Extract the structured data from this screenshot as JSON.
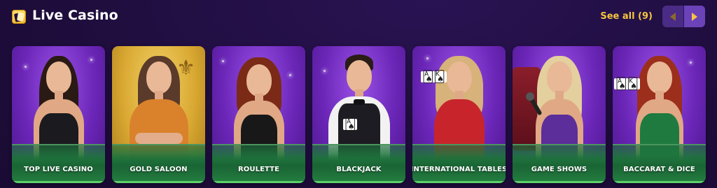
{
  "header": {
    "title": "Live Casino",
    "title_icon": "cards-icon",
    "see_all_label": "See all (9)",
    "prev_icon": "chevron-left-icon",
    "next_icon": "chevron-right-icon"
  },
  "colors": {
    "background": "#1e0d3c",
    "accent_gold": "#f5c542",
    "card_purple": "#7a32c9",
    "card_gold": "#e2b33a",
    "table_green": "#1f7a3f",
    "label_underline": "#5cd06a"
  },
  "cards": [
    {
      "label": "TOP LIVE CASINO",
      "theme": "purple",
      "hair": "#2a1a14",
      "dress": "#1b1b1f"
    },
    {
      "label": "GOLD SALOON",
      "theme": "gold",
      "hair": "#5a3a2a",
      "dress": "#d9822b"
    },
    {
      "label": "ROULETTE",
      "theme": "purple",
      "hair": "#7a2a16",
      "dress": "#181818"
    },
    {
      "label": "BLACKJACK",
      "theme": "purple",
      "hair": "#2a1d16",
      "dress": "#1c1c22"
    },
    {
      "label": "INTERNATIONAL TABLES",
      "theme": "purple",
      "hair": "#d7b27a",
      "dress": "#c8242b"
    },
    {
      "label": "GAME SHOWS",
      "theme": "purple",
      "hair": "#e4cf9e",
      "dress": "#5b2e9a"
    },
    {
      "label": "BACCARAT & DICE",
      "theme": "purple",
      "hair": "#9c2e1c",
      "dress": "#1f7a3f"
    }
  ]
}
